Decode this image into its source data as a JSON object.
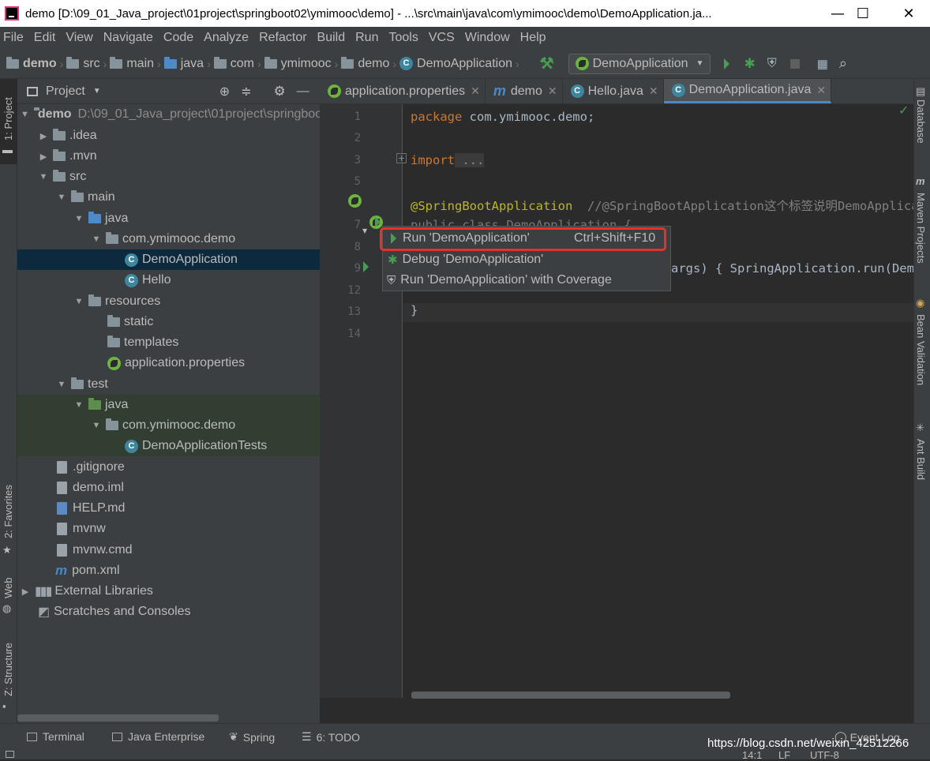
{
  "window": {
    "title": "demo [D:\\09_01_Java_project\\01project\\springboot02\\ymimooc\\demo] - ...\\src\\main\\java\\com\\ymimooc\\demo\\DemoApplication.ja...",
    "minimize": "—",
    "maximize": "☐",
    "close": "✕"
  },
  "menu": [
    "File",
    "Edit",
    "View",
    "Navigate",
    "Code",
    "Analyze",
    "Refactor",
    "Build",
    "Run",
    "Tools",
    "VCS",
    "Window",
    "Help"
  ],
  "breadcrumbs": [
    "demo",
    "src",
    "main",
    "java",
    "com",
    "ymimooc",
    "demo",
    "DemoApplication"
  ],
  "run_config": "DemoApplication",
  "left_tools": {
    "project": "1: Project",
    "favorites": "2: Favorites",
    "web": "Web",
    "structure": "Z: Structure"
  },
  "right_tools": {
    "database": "Database",
    "maven": "Maven Projects",
    "bean": "Bean Validation",
    "ant": "Ant Build"
  },
  "project_panel": {
    "title": "Project",
    "tree": [
      {
        "label": "demo",
        "extra": "D:\\09_01_Java_project\\01project\\springboot02\\ymimooc\\demo"
      },
      {
        "label": ".idea"
      },
      {
        "label": ".mvn"
      },
      {
        "label": "src"
      },
      {
        "label": "main"
      },
      {
        "label": "java"
      },
      {
        "label": "com.ymimooc.demo"
      },
      {
        "label": "DemoApplication"
      },
      {
        "label": "Hello"
      },
      {
        "label": "resources"
      },
      {
        "label": "static"
      },
      {
        "label": "templates"
      },
      {
        "label": "application.properties"
      },
      {
        "label": "test"
      },
      {
        "label": "java"
      },
      {
        "label": "com.ymimooc.demo"
      },
      {
        "label": "DemoApplicationTests"
      },
      {
        "label": ".gitignore"
      },
      {
        "label": "demo.iml"
      },
      {
        "label": "HELP.md"
      },
      {
        "label": "mvnw"
      },
      {
        "label": "mvnw.cmd"
      },
      {
        "label": "pom.xml"
      },
      {
        "label": "External Libraries"
      },
      {
        "label": "Scratches and Consoles"
      }
    ]
  },
  "tabs": [
    {
      "label": "application.properties"
    },
    {
      "label": "demo"
    },
    {
      "label": "Hello.java"
    },
    {
      "label": "DemoApplication.java"
    }
  ],
  "editor": {
    "line_numbers": [
      "1",
      "2",
      "3",
      "5",
      "6",
      "7",
      "8",
      "9",
      "12",
      "13",
      "14"
    ],
    "line1_kw": "package",
    "line1_rest": " com.ymimooc.demo;",
    "line3_kw": "import",
    "line3_fold": " ...",
    "line6_ann": "@SpringBootApplication",
    "line6_cm": "  //@SpringBootApplication这个标签说明DemoApplica",
    "line7_partial": "public class DemoApplication {",
    "line9_tail": "args) { SpringApplication.run(Demo",
    "line13": "}"
  },
  "popup": {
    "items": [
      {
        "label": "Run 'DemoApplication'",
        "shortcut": "Ctrl+Shift+F10"
      },
      {
        "label": "Debug 'DemoApplication'",
        "shortcut": ""
      },
      {
        "label": "Run 'DemoApplication' with Coverage",
        "shortcut": ""
      }
    ]
  },
  "bottom_tools": [
    "Terminal",
    "Java Enterprise",
    "Spring",
    "6: TODO"
  ],
  "event_log": "Event Log",
  "status": {
    "position": "14:1",
    "line_sep": "LF",
    "encoding": "UTF-8"
  },
  "watermark": "https://blog.csdn.net/weixin_42512266",
  "colors": {
    "accent_red": "#e8302e",
    "run_green": "#499c54",
    "tab_blue": "#4a88c7"
  }
}
